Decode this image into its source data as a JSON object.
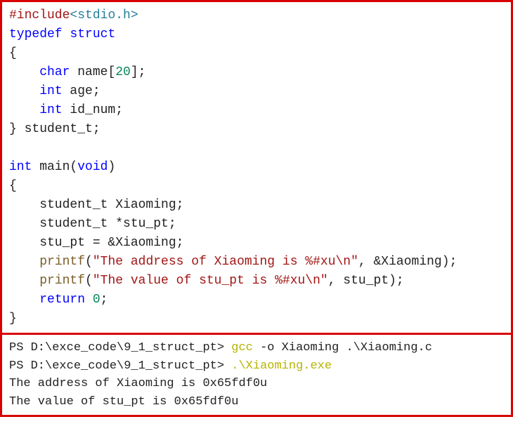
{
  "code": {
    "include_kw": "#include",
    "include_open": "<",
    "include_file": "stdio.h",
    "include_close": ">",
    "typedef": "typedef",
    "struct": "struct",
    "lbrace": "{",
    "rbrace_struct": "} ",
    "struct_name": "student_t;",
    "char": "char",
    "name_field": " name[",
    "name_size": "20",
    "name_close": "];",
    "int": "int",
    "age_field": " age;",
    "id_field": " id_num;",
    "main_decl_int": "int",
    "main_name": " main(",
    "void": "void",
    "main_close": ")",
    "decl1": "    student_t Xiaoming;",
    "decl2": "    student_t *stu_pt;",
    "assign": "    stu_pt = &Xiaoming;",
    "printf": "printf",
    "str1": "\"The address of Xiaoming is %#xu\\n\"",
    "args1": ", &Xiaoming);",
    "str2": "\"The value of stu_pt is %#xu\\n\"",
    "args2": ", stu_pt);",
    "return": "return",
    "zero": " 0",
    "semi": ";",
    "rbrace": "}"
  },
  "terminal": {
    "prompt": "PS D:\\exce_code\\9_1_struct_pt> ",
    "cmd1": "gcc ",
    "cmd1_rest": "-o Xiaoming .\\Xiaoming.c",
    "cmd2": ".\\Xiaoming.exe",
    "out1": "The address of Xiaoming is 0x65fdf0u",
    "out2": "The value of stu_pt is 0x65fdf0u"
  }
}
